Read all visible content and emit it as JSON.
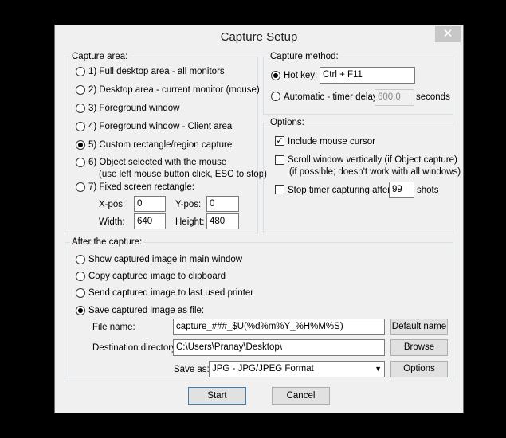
{
  "window": {
    "title": "Capture Setup",
    "close_glyph": "✕"
  },
  "capture_area": {
    "label": "Capture area:",
    "options": [
      "1) Full desktop area - all monitors",
      "2) Desktop area - current monitor (mouse)",
      "3) Foreground window",
      "4) Foreground window - Client area",
      "5) Custom rectangle/region capture",
      "6) Object selected with the mouse",
      "7) Fixed screen rectangle:"
    ],
    "option6_note": "(use left mouse button click, ESC to stop)",
    "selected_index": 4,
    "xpos_label": "X-pos:",
    "xpos_value": "0",
    "ypos_label": "Y-pos:",
    "ypos_value": "0",
    "width_label": "Width:",
    "width_value": "640",
    "height_label": "Height:",
    "height_value": "480"
  },
  "capture_method": {
    "label": "Capture method:",
    "hotkey_label": "Hot key:",
    "hotkey_value": "Ctrl + F11",
    "automatic_label": "Automatic - timer delay:",
    "timer_value": "600.0",
    "seconds_label": "seconds",
    "selected": "hotkey"
  },
  "options": {
    "label": "Options:",
    "include_cursor": "Include mouse cursor",
    "include_cursor_checked": true,
    "scroll_window": "Scroll window vertically (if Object capture)",
    "scroll_note": "(if possible; doesn't work with all windows)",
    "scroll_checked": false,
    "stop_timer": "Stop timer capturing after:",
    "stop_timer_value": "99",
    "shots_label": "shots",
    "stop_timer_checked": false
  },
  "after_capture": {
    "label": "After the capture:",
    "options": [
      "Show captured image in main window",
      "Copy captured image to clipboard",
      "Send captured image to last used printer",
      "Save captured image as file:"
    ],
    "selected_index": 3,
    "filename_label": "File name:",
    "filename_value": "capture_###_$U(%d%m%Y_%H%M%S)",
    "default_name_button": "Default name",
    "dest_label": "Destination directory:",
    "dest_value": "C:\\Users\\Pranay\\Desktop\\",
    "browse_button": "Browse",
    "saveas_label": "Save as:",
    "saveas_value": "JPG - JPG/JPEG Format",
    "options_button": "Options"
  },
  "buttons": {
    "start": "Start",
    "cancel": "Cancel"
  }
}
